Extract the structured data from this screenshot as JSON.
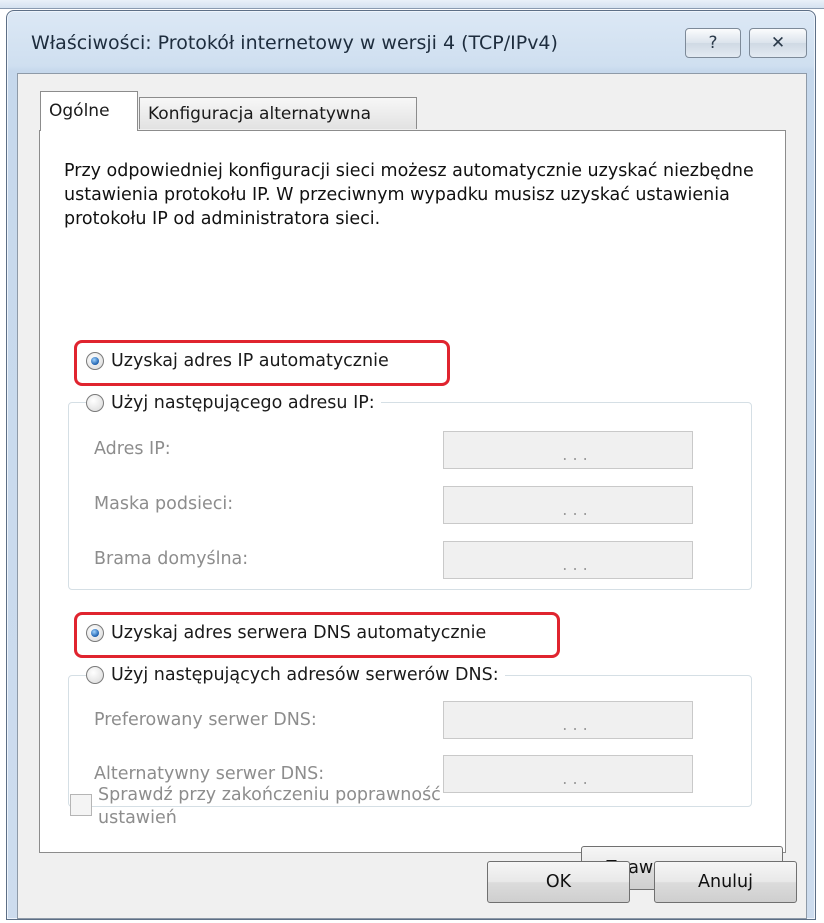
{
  "window": {
    "title": "Właściwości: Protokół internetowy w wersji 4 (TCP/IPv4)",
    "help_glyph": "?",
    "close_glyph": "✕"
  },
  "tabs": [
    {
      "label": "Ogólne",
      "active": true
    },
    {
      "label": "Konfiguracja alternatywna",
      "active": false
    }
  ],
  "description": "Przy odpowiedniej konfiguracji sieci możesz automatycznie uzyskać niezbędne ustawienia protokołu IP. W przeciwnym wypadku musisz uzyskać ustawienia protokołu IP od administratora sieci.",
  "ip_section": {
    "auto_label": "Uzyskaj adres IP automatycznie",
    "auto_checked": true,
    "manual_label": "Użyj następującego adresu IP:",
    "manual_checked": false,
    "fields": [
      {
        "label": "Adres IP:",
        "value": "   .   .   ."
      },
      {
        "label": "Maska podsieci:",
        "value": "   .   .   ."
      },
      {
        "label": "Brama domyślna:",
        "value": "   .   .   ."
      }
    ]
  },
  "dns_section": {
    "auto_label": "Uzyskaj adres serwera DNS automatycznie",
    "auto_checked": true,
    "manual_label": "Użyj następujących adresów serwerów DNS:",
    "manual_checked": false,
    "fields": [
      {
        "label": "Preferowany serwer DNS:",
        "value": "   .   .   ."
      },
      {
        "label": "Alternatywny serwer DNS:",
        "value": "   .   .   ."
      }
    ]
  },
  "validate_label": "Sprawdź przy zakończeniu poprawność ustawień",
  "validate_checked": false,
  "advanced_button": "Zaawansowane...",
  "ok_button": "OK",
  "cancel_button": "Anuluj",
  "colors": {
    "highlight": "#e0242f",
    "radio_selected": "#1c5fae",
    "disabled_text": "#8d8d8d"
  }
}
